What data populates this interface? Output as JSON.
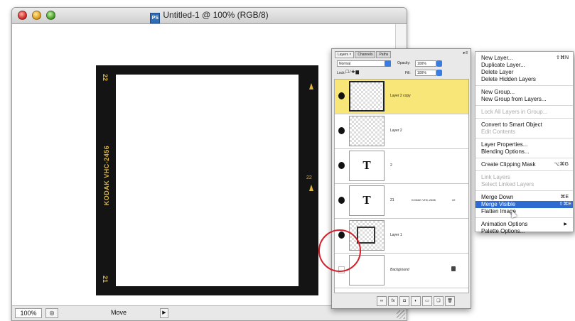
{
  "window": {
    "title": "Untitled-1 @ 100% (RGB/8)",
    "doc_icon_label": "PS",
    "status": {
      "zoom": "100%",
      "tool": "Move"
    }
  },
  "film": {
    "number_top": "22",
    "number_bottom": "21",
    "brand": "KODAK VHC-2456",
    "mid_number": "22"
  },
  "palette": {
    "tabs": [
      "Layers ×",
      "Channels",
      "Paths"
    ],
    "blend_mode": "Normal",
    "opacity_label": "Opacity:",
    "opacity_value": "100%",
    "lock_label": "Lock:",
    "fill_label": "Fill:",
    "fill_value": "100%",
    "layers": [
      {
        "name": "Layer 2 copy"
      },
      {
        "name": "Layer 2"
      },
      {
        "name": "2"
      },
      {
        "name": "21",
        "extra": "KODAK VHC-2456",
        "extra2": "22"
      },
      {
        "name": "Layer 1"
      },
      {
        "name": "Background"
      }
    ],
    "bottom_icons": [
      "link-icon",
      "fx-icon",
      "mask-icon",
      "adjustment-icon",
      "folder-icon",
      "new-layer-icon",
      "trash-icon"
    ]
  },
  "menu": {
    "items": [
      {
        "label": "New Layer...",
        "shortcut": "⇧⌘N"
      },
      {
        "label": "Duplicate Layer..."
      },
      {
        "label": "Delete Layer"
      },
      {
        "label": "Delete Hidden Layers"
      },
      {
        "label": "New Group..."
      },
      {
        "label": "New Group from Layers..."
      },
      {
        "label": "Lock All Layers in Group..."
      },
      {
        "label": "Convert to Smart Object"
      },
      {
        "label": "Edit Contents"
      },
      {
        "label": "Layer Properties..."
      },
      {
        "label": "Blending Options..."
      },
      {
        "label": "Create Clipping Mask",
        "shortcut": "⌥⌘G"
      },
      {
        "label": "Link Layers"
      },
      {
        "label": "Select Linked Layers"
      },
      {
        "label": "Merge Down",
        "shortcut": "⌘E"
      },
      {
        "label": "Merge Visible",
        "shortcut": "⇧⌘E"
      },
      {
        "label": "Flatten Image"
      },
      {
        "label": "Animation Options"
      },
      {
        "label": "Palette Options..."
      }
    ]
  },
  "colors": {
    "selected_layer": "#f9e678",
    "menu_highlight": "#2e6bd0",
    "annotation_circle": "#d4202a",
    "film_accent": "#e0b640"
  }
}
